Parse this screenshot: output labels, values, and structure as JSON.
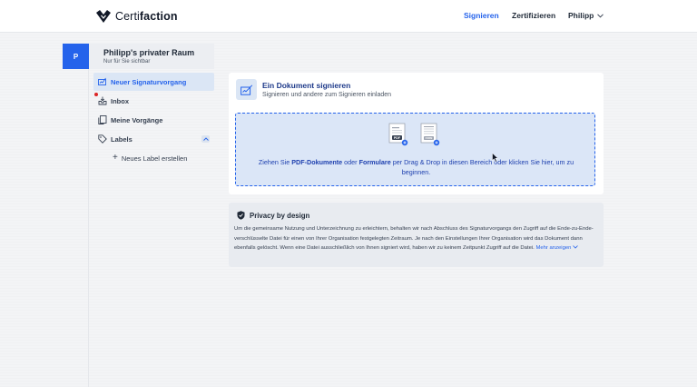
{
  "header": {
    "logo_light": "Certi",
    "logo_bold": "faction",
    "nav_sign": "Signieren",
    "nav_certify": "Zertifizieren",
    "user_name": "Philipp"
  },
  "space": {
    "avatar_letter": "P",
    "name": "Philipp's privater Raum",
    "subtitle": "Nur für Sie sichtbar"
  },
  "sidebar": {
    "items": [
      {
        "label": "Neuer Signaturvorgang",
        "icon": "signature-icon",
        "active": true
      },
      {
        "label": "Inbox",
        "icon": "inbox-icon",
        "active": false
      },
      {
        "label": "Meine Vorgänge",
        "icon": "documents-icon",
        "active": false
      },
      {
        "label": "Labels",
        "icon": "tag-icon",
        "active": false
      }
    ],
    "new_label": "Neues Label erstellen"
  },
  "main": {
    "title": "Ein Dokument signieren",
    "subtitle": "Signieren und andere zum Signieren einladen",
    "drop": {
      "part1": "Ziehen Sie ",
      "bold1": "PDF-Dokumente",
      "part2": " oder ",
      "bold2": "Formulare",
      "part3": " per Drag & Drop in diesen Bereich oder klicken Sie hier, um zu beginnen.",
      "doc_badge_1": "PDF",
      "doc_badge_2": "FORM"
    }
  },
  "privacy": {
    "title": "Privacy by design",
    "body": "Um die gemeinsame Nutzung und Unterzeichnung zu erleichtern, behalten wir nach Abschluss des Signaturvorgangs den Zugriff auf die Ende-zu-Ende-verschlüsselte Datei für einen von Ihrer Organisation festgelegten Zeitraum. Je nach den Einstellungen Ihrer Organisation wird das Dokument dann ebenfalls gelöscht. Wenn eine Datei ausschließlich von Ihnen signiert wird, haben wir zu keinem Zeitpunkt Zugriff auf die Datei.",
    "more": "Mehr anzeigen"
  },
  "colors": {
    "accent": "#2563eb",
    "active_bg": "#dbe6f5",
    "dropzone_bg": "#dbe6f7",
    "notification": "#dc2626"
  }
}
